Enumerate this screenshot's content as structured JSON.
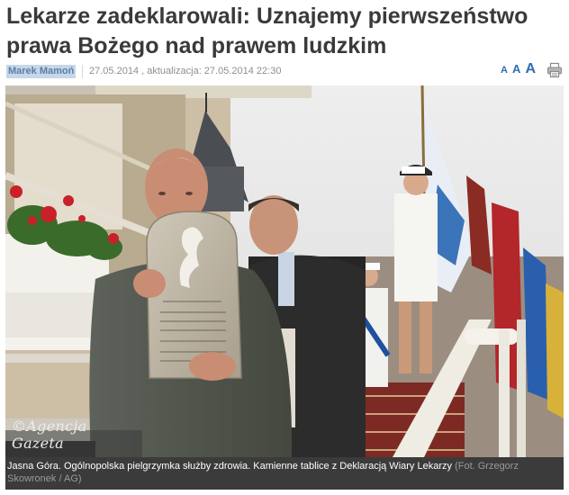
{
  "article": {
    "title": "Lekarze zadeklarowali: Uznajemy pierwszeństwo prawa Bożego nad prawem ludzkim",
    "author": "Marek Mamoń",
    "dates": "27.05.2014 , aktualizacja: 27.05.2014 22:30"
  },
  "toolbar": {
    "font_small": "A",
    "font_medium": "A",
    "font_large": "A"
  },
  "photo": {
    "watermark": "©Agencja Gazeta",
    "tablet_text": "Kamienne tablice z Deklaracją Wiary Lekarzy"
  },
  "caption": {
    "text": "Jasna Góra. Ogólnopolska pielgrzymka służby zdrowia. Kamienne tablice z Deklaracją Wiary Lekarzy",
    "credit": "(Fot. Grzegorz Skowronek / AG)"
  },
  "colors": {
    "title": "#3a3a3a",
    "author_link": "#5a7fa5",
    "font_controls": "#2c6db5",
    "caption_bg": "#3b3b3b"
  }
}
